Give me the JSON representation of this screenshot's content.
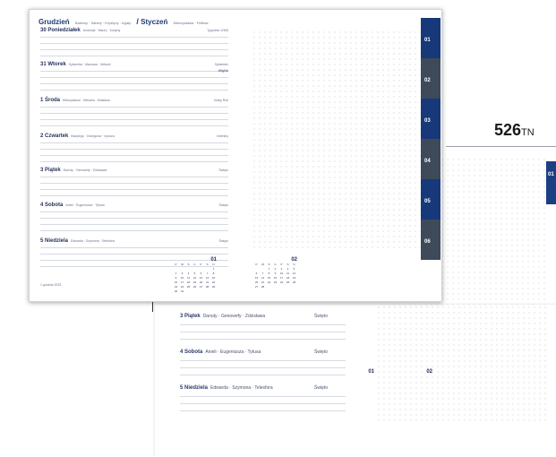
{
  "code": {
    "number": "526",
    "suffix": "TN"
  },
  "right_tab": {
    "label": "01"
  },
  "month_header": {
    "month1": "Grudzień",
    "month1_sub": "Barbary · Sabiny · Krystyny · Agaty",
    "separator": "/",
    "month2": "Styczeń",
    "month2_sub": "Mieczysława · Feliksa"
  },
  "days": [
    {
      "title": "30 Poniedziałek",
      "names": "Andrzeja · Maury · Justyny",
      "right": "Tygodnia 1/365",
      "right2": ""
    },
    {
      "title": "31 Wtorek",
      "names": "Sylwestra · Mariusza · Melanii",
      "right": "Sylwester",
      "right2": "Wigilia"
    },
    {
      "title": "1 Środa",
      "names": "Mieczysława · Mieszka · Masława",
      "right": "Nowy Rok",
      "right2": ""
    },
    {
      "title": "2 Czwartek",
      "names": "Bazylego · Grzegorza · Izydora",
      "right": "Imieniny",
      "right2": ""
    },
    {
      "title": "3 Piątek",
      "names": "Danuty · Genowefy · Zdzisława",
      "right": "Święto",
      "right2": ""
    },
    {
      "title": "4 Sobota",
      "names": "Anieli · Eugeniusza · Tytusa",
      "right": "Święto",
      "right2": ""
    },
    {
      "title": "5 Niedziela",
      "names": "Edwarda · Szymona · Telesfora",
      "right": "Święto",
      "right2": ""
    }
  ],
  "calendars": [
    {
      "month_num": "01",
      "weekdays": [
        "P",
        "W",
        "Ś",
        "C",
        "P",
        "S",
        "N"
      ],
      "days": [
        "",
        "",
        "",
        "",
        "",
        "",
        "1",
        "2",
        "3",
        "4",
        "5",
        "6",
        "7",
        "8",
        "9",
        "10",
        "11",
        "12",
        "13",
        "14",
        "15",
        "16",
        "17",
        "18",
        "19",
        "20",
        "21",
        "22",
        "23",
        "24",
        "25",
        "26",
        "27",
        "28",
        "29",
        "30",
        "31"
      ]
    },
    {
      "month_num": "02",
      "weekdays": [
        "P",
        "W",
        "Ś",
        "C",
        "P",
        "S",
        "N"
      ],
      "days": [
        "",
        "",
        "1",
        "2",
        "3",
        "4",
        "5",
        "6",
        "7",
        "8",
        "9",
        "10",
        "11",
        "12",
        "13",
        "14",
        "15",
        "16",
        "17",
        "18",
        "19",
        "20",
        "21",
        "22",
        "23",
        "24",
        "25",
        "26",
        "27",
        "28"
      ]
    }
  ],
  "tabs": [
    {
      "label": "01",
      "style": "blue"
    },
    {
      "label": "02",
      "style": "grey"
    },
    {
      "label": "03",
      "style": "blue"
    },
    {
      "label": "04",
      "style": "grey"
    },
    {
      "label": "05",
      "style": "blue"
    },
    {
      "label": "06",
      "style": "grey"
    }
  ],
  "footer": "1 grudnia 2023",
  "back_days": [
    {
      "title": "3 Piątek",
      "names": "Danuty · Genowefy · Zdzisława",
      "right": "Święto"
    },
    {
      "title": "4 Sobota",
      "names": "Anieli · Eugeniusza · Tytusa",
      "right": "Święto"
    },
    {
      "title": "5 Niedziela",
      "names": "Edwarda · Szymona · Telesfora",
      "right": "Święto"
    }
  ],
  "back_cal": [
    {
      "month_num": "01"
    },
    {
      "month_num": "02"
    }
  ]
}
